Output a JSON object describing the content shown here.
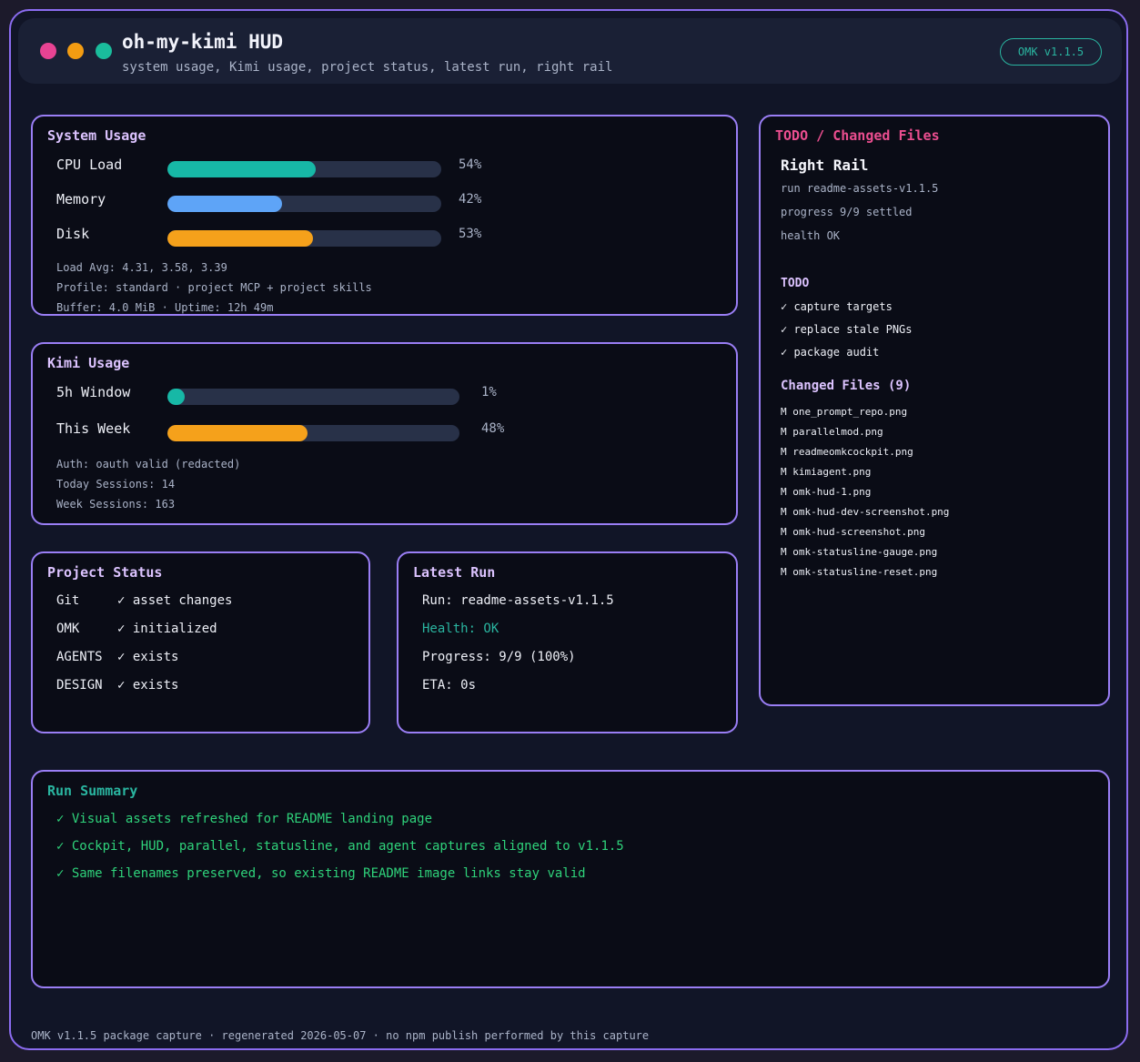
{
  "header": {
    "title": "oh-my-kimi HUD",
    "subtitle": "system usage, Kimi usage, project status, latest run, right rail",
    "version_badge": "OMK v1.1.5",
    "window_dots": [
      "#e84393",
      "#f39c12",
      "#1abc9c"
    ]
  },
  "system_usage": {
    "title": "System Usage",
    "rows": [
      {
        "label": "CPU Load",
        "value": 54,
        "display": "54%",
        "color": "#17b8a6"
      },
      {
        "label": "Memory",
        "value": 42,
        "display": "42%",
        "color": "#5ea4f7"
      },
      {
        "label": "Disk",
        "value": 53,
        "display": "53%",
        "color": "#f5a11b"
      }
    ],
    "meta": [
      "Load Avg: 4.31, 3.58, 3.39",
      "Profile: standard · project MCP + project skills",
      "Buffer: 4.0 MiB · Uptime: 12h 49m"
    ]
  },
  "kimi_usage": {
    "title": "Kimi Usage",
    "rows": [
      {
        "label": "5h Window",
        "value": 1,
        "display": "1%",
        "color": "#17b8a6"
      },
      {
        "label": "This Week",
        "value": 48,
        "display": "48%",
        "color": "#f5a11b"
      }
    ],
    "meta": [
      "Auth: oauth valid (redacted)",
      "Today Sessions: 14",
      "Week Sessions: 163"
    ]
  },
  "project_status": {
    "title": "Project Status",
    "rows": [
      {
        "key": "Git",
        "value": "✓ asset changes"
      },
      {
        "key": "OMK",
        "value": "✓ initialized"
      },
      {
        "key": "AGENTS",
        "value": "✓ exists"
      },
      {
        "key": "DESIGN",
        "value": "✓ exists"
      }
    ]
  },
  "latest_run": {
    "title": "Latest Run",
    "run": "Run: readme-assets-v1.1.5",
    "health": "Health: OK",
    "progress": "Progress: 9/9 (100%)",
    "eta": "ETA: 0s"
  },
  "right_rail": {
    "title": "TODO / Changed Files",
    "heading": "Right Rail",
    "lines": [
      "run readme-assets-v1.1.5",
      "progress 9/9 settled",
      "health OK"
    ],
    "todo_title": "TODO",
    "todo": [
      "✓ capture targets",
      "✓ replace stale PNGs",
      "✓ package audit"
    ],
    "changed_title": "Changed Files (9)",
    "files": [
      "M one_prompt_repo.png",
      "M parallelmod.png",
      "M readmeomkcockpit.png",
      "M kimiagent.png",
      "M omk-hud-1.png",
      "M omk-hud-dev-screenshot.png",
      "M omk-hud-screenshot.png",
      "M omk-statusline-gauge.png",
      "M omk-statusline-reset.png"
    ]
  },
  "run_summary": {
    "title": "Run Summary",
    "lines": [
      "✓ Visual assets refreshed for README landing page",
      "✓ Cockpit, HUD, parallel, statusline, and agent captures aligned to v1.1.5",
      "✓ Same filenames preserved, so existing README image links stay valid"
    ]
  },
  "footer": "OMK v1.1.5 package capture · regenerated 2026-05-07 · no npm publish performed by this capture"
}
